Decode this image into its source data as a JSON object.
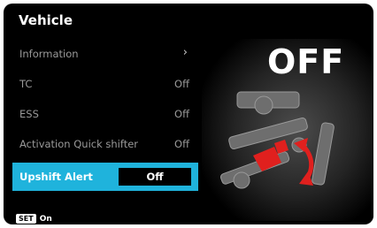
{
  "screen": {
    "title": "Vehicle"
  },
  "menu": {
    "items": [
      {
        "label": "Information",
        "value": "",
        "has_chevron": true
      },
      {
        "label": "TC",
        "value": "Off"
      },
      {
        "label": "ESS",
        "value": "Off"
      },
      {
        "label": "Activation Quick shifter",
        "value": "Off"
      },
      {
        "label": "Upshift Alert",
        "value": "Off",
        "selected": true
      }
    ],
    "chevron": "›"
  },
  "status_display": {
    "text": "OFF"
  },
  "footer": {
    "button": "SET",
    "action": "On"
  },
  "colors": {
    "accent": "#1fb3dc",
    "arrow": "#e0201e",
    "background": "#000000"
  },
  "icons": {
    "chevron": "chevron-right-icon",
    "shifter": "gear-shifter-illustration"
  }
}
